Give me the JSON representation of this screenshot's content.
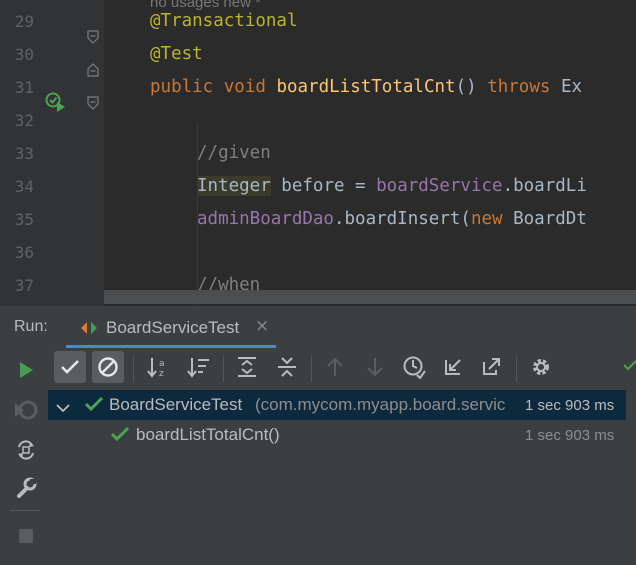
{
  "editor": {
    "usages_hint": "no usages   new *",
    "lines": [
      {
        "num": "29",
        "tokens": [
          {
            "t": "@Transactional",
            "c": "ann"
          }
        ]
      },
      {
        "num": "30",
        "tokens": [
          {
            "t": "@Test",
            "c": "ann"
          }
        ]
      },
      {
        "num": "31",
        "tokens": [
          {
            "t": "public ",
            "c": "kw"
          },
          {
            "t": "void ",
            "c": "kw"
          },
          {
            "t": "boardListTotalCnt",
            "c": "fn"
          },
          {
            "t": "() ",
            "c": ""
          },
          {
            "t": "throws ",
            "c": "kw"
          },
          {
            "t": "Ex",
            "c": ""
          }
        ]
      },
      {
        "num": "32",
        "tokens": []
      },
      {
        "num": "33",
        "tokens": [
          {
            "t": "//given",
            "c": "cm"
          }
        ]
      },
      {
        "num": "34",
        "tokens": [
          {
            "t": "Integer",
            "c": "tyhl"
          },
          {
            "t": " before = ",
            "c": ""
          },
          {
            "t": "boardService",
            "c": "field"
          },
          {
            "t": ".boardLi",
            "c": ""
          }
        ]
      },
      {
        "num": "35",
        "tokens": [
          {
            "t": "adminBoardDao",
            "c": "field"
          },
          {
            "t": ".boardInsert(",
            "c": ""
          },
          {
            "t": "new ",
            "c": "kw"
          },
          {
            "t": "BoardDt",
            "c": ""
          }
        ]
      },
      {
        "num": "36",
        "tokens": []
      },
      {
        "num": "37",
        "tokens": [
          {
            "t": "//when",
            "c": "cm"
          }
        ]
      }
    ]
  },
  "run_panel": {
    "label": "Run:",
    "tab_label": "BoardServiceTest",
    "tab_close": "×",
    "tree": {
      "root": {
        "name": "BoardServiceTest",
        "package": "(com.mycom.myapp.board.servic",
        "time": "1 sec 903 ms"
      },
      "children": [
        {
          "name": "boardListTotalCnt()",
          "time": "1 sec 903 ms"
        }
      ]
    }
  },
  "colors": {
    "pass_green": "#4aa552",
    "run_green": "#499c54",
    "selection": "#0d293e",
    "tab_underline": "#4a88c7"
  }
}
